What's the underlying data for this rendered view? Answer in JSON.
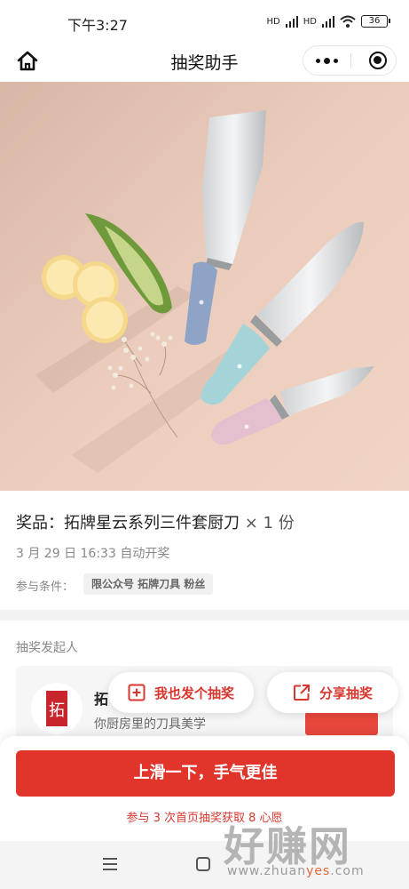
{
  "status_bar": {
    "time": "下午3:27",
    "network_label": "HD",
    "battery": "36"
  },
  "nav": {
    "title": "抽奖助手"
  },
  "prize": {
    "title": "奖品：拓牌星云系列三件套厨刀",
    "quantity": "× 1 份",
    "draw_time": "3 月 29 日 16:33 自动开奖",
    "condition_label": "参与条件：",
    "condition_tag": "限公众号 拓牌刀具 粉丝"
  },
  "sponsor": {
    "section_label": "抽奖发起人",
    "name": "拓",
    "description": "你厨房里的刀具美学",
    "avatar_text": "拓"
  },
  "float_buttons": {
    "create_label": "我也发个抽奖",
    "share_label": "分享抽奖"
  },
  "bottom": {
    "main_button": "上滑一下，手气更佳",
    "hint": "参与 3 次首页抽奖获取 8 心愿"
  },
  "watermark": {
    "big": "好赚网",
    "small_a": "www.zhuan",
    "small_b": "yes",
    "small_c": ".com"
  },
  "colors": {
    "accent": "#e1352b",
    "image_background": "#e9c8b7"
  },
  "icons": [
    "home-icon",
    "more-icon",
    "close-icon",
    "add-square-icon",
    "share-icon",
    "menu-icon",
    "home-key-icon",
    "signal-icon",
    "wifi-icon",
    "battery-icon"
  ]
}
